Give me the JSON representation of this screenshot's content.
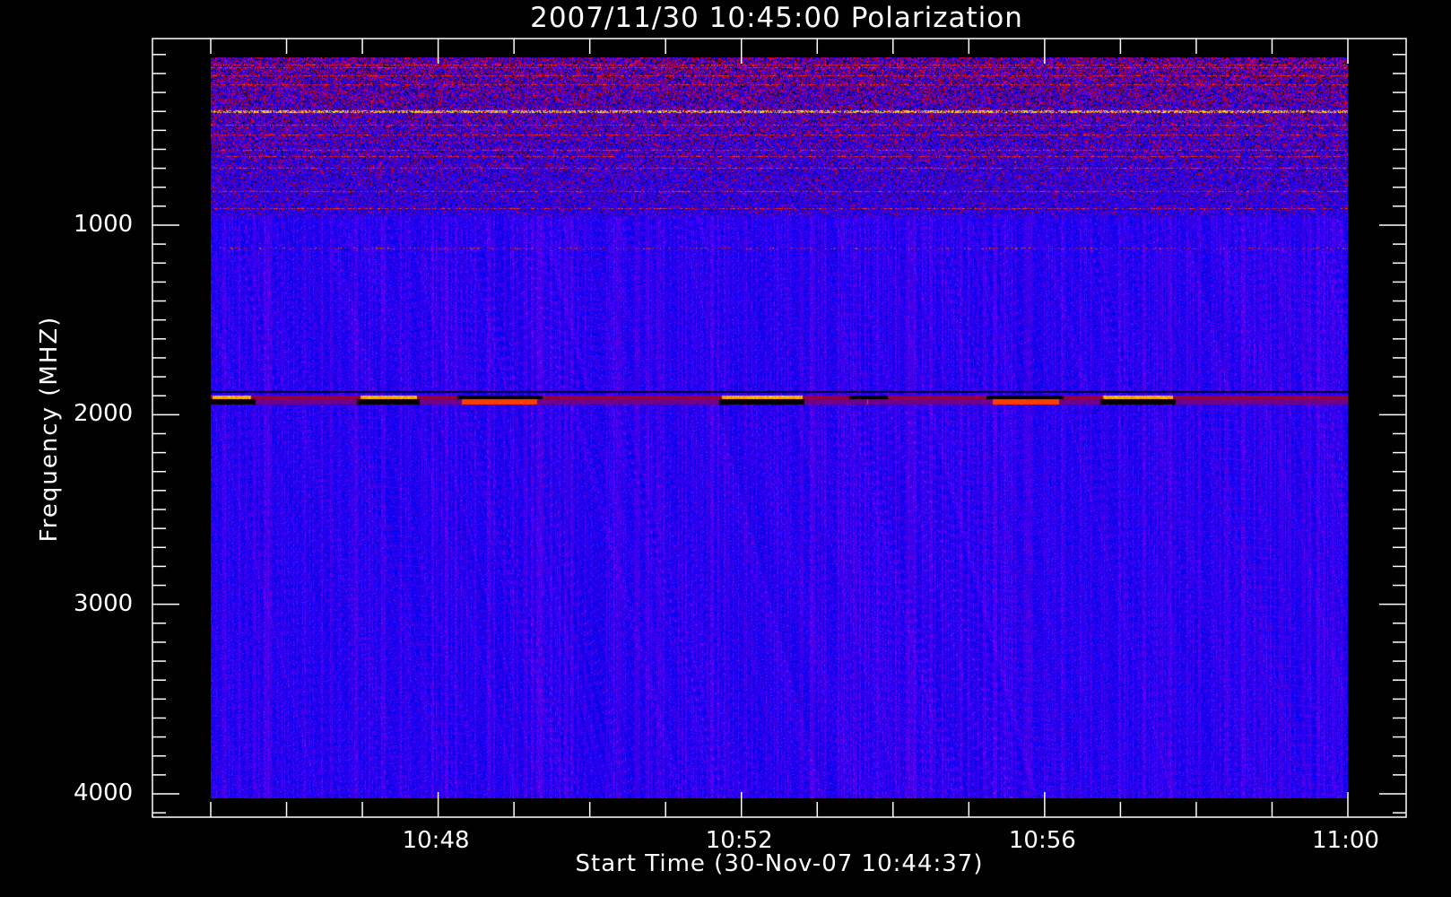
{
  "chart_data": {
    "type": "heatmap",
    "title": "2007/11/30 10:45:00 Polarization",
    "xlabel": "Start Time (30-Nov-07 10:44:37)",
    "ylabel": "Frequency (MHZ)",
    "x_range": [
      "10:45",
      "11:00"
    ],
    "x_ticks": [
      "10:48",
      "10:52",
      "10:56",
      "11:00"
    ],
    "x_minor_tick_interval_min": 1,
    "y_range": [
      115,
      4020
    ],
    "y_inverted": true,
    "y_ticks": [
      1000,
      2000,
      3000,
      4000
    ],
    "y_minor_tick_interval": 100,
    "colormap": [
      "#000000",
      "#800000",
      "#ff0000",
      "#ff8000",
      "#ffff00",
      "#ffffff",
      "#0000ff"
    ],
    "background_color": "#0000ff",
    "features": [
      {
        "description": "noisy interference band",
        "freq_range": [
          115,
          950
        ]
      },
      {
        "description": "bright line",
        "freq": 400
      },
      {
        "description": "intermittent emission line",
        "freq": 1120
      },
      {
        "description": "strong band with red/yellow/black segments",
        "freq_range": [
          1870,
          1950
        ]
      }
    ]
  }
}
